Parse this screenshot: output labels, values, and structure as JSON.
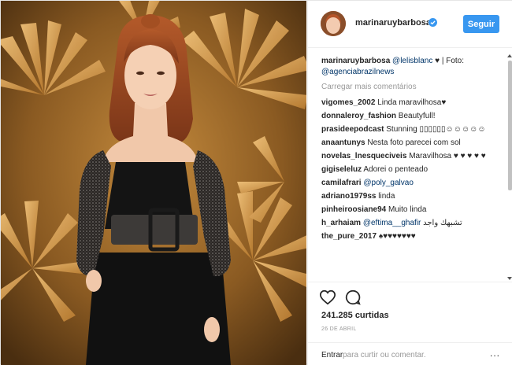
{
  "header": {
    "username": "marinaruybarbosa",
    "follow_label": "Seguir"
  },
  "caption": {
    "username": "marinaruybarbosa",
    "mention": "@lelisblanc",
    "text_after_mention": "♥ | Foto:",
    "credit": "@agenciabrazilnews"
  },
  "load_more_label": "Carregar mais comentários",
  "comments": [
    {
      "user": "vigomes_2002",
      "text": "Linda maravilhosa♥"
    },
    {
      "user": "donnaleroy_fashion",
      "text": "Beautyfull!"
    },
    {
      "user": "prasideepodcast",
      "text": "Stunning ▯▯▯▯▯▯☺☺☺☺☺"
    },
    {
      "user": "anaantunys",
      "text": "Nesta foto parecei com sol"
    },
    {
      "user": "novelas_lnesqueciveis",
      "text": "Maravilhosa ♥ ♥ ♥ ♥ ♥"
    },
    {
      "user": "gigiseleluz",
      "text": "Adorei o penteado"
    },
    {
      "user": "camilafrari",
      "mention": "@poly_galvao"
    },
    {
      "user": "adriano1979ss",
      "text": "linda"
    },
    {
      "user": "pinheiroosiane94",
      "text": "Muito linda"
    },
    {
      "user": "h_arhaiam",
      "mention": "@eftima__ghafir",
      "text": "تشبهك واجد"
    },
    {
      "user": "the_pure_2017",
      "text": "♠♥♥♥♥♥♥♥"
    }
  ],
  "actions": {
    "like_icon": "heart-icon",
    "comment_icon": "comment-bubble-icon"
  },
  "likes_text": "241.285 curtidas",
  "date_text": "26 DE ABRIL",
  "login": {
    "link": "Entrar",
    "rest": "para curtir ou comentar.",
    "more": "..."
  },
  "colors": {
    "accent": "#3897f0",
    "link": "#003569",
    "muted": "#999999",
    "text": "#262626"
  }
}
